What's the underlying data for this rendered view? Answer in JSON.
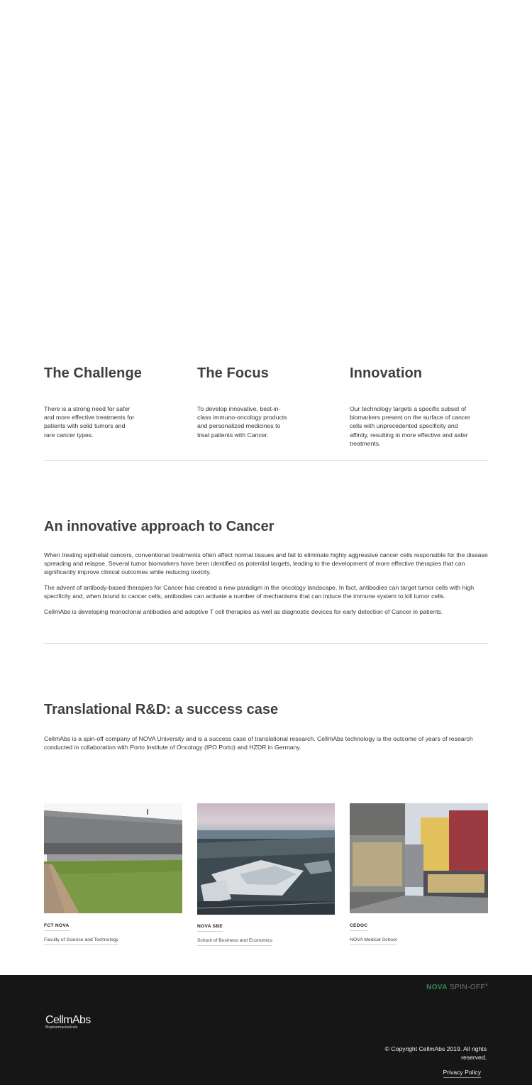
{
  "pillars": [
    {
      "title": "The Challenge",
      "lines": [
        "There is a strong need for safer",
        "and more effective treatments for",
        "patients with solid tumors and",
        "rare cancer types."
      ]
    },
    {
      "title": "The Focus",
      "lines": [
        "To develop innovative, best-in-",
        "class immuno-oncology products",
        "and personalized medicines to",
        "treat patients with Cancer."
      ]
    },
    {
      "title": "Innovation",
      "lines": [
        "Our technology targets a specific subset of",
        "biomarkers present on the surface of cancer",
        "cells with unprecedented specificity and",
        "affinity, resulting in more effective and safer",
        "treatments."
      ]
    }
  ],
  "approach": {
    "title": "An innovative approach to Cancer",
    "paragraphs": [
      "When treating epithelial cancers,  conventional treatments often affect normal tissues and fail to  eliminate highly aggressive cancer cells responsible for the disease  spreading and relapse. Several tumor biomarkers have been identified as  potential targets, leading to the development of more effective therapies that can significantly improve clinical outcomes while  reducing toxicity.",
      "The advent of antibody-based therapies for  Cancer has created a new paradigm in the oncology landscape. In fact,  antibodies can target tumor cells with high specificity and, when bound  to cancer cells, antibodies can activate a number of mechanisms that can  induce the immune system to kill tumor cells.",
      "CellmAbs is developing monoclonal antibodies and  adoptive T cell therapies as well as diagnostic devices for early  detection of Cancer in patients."
    ]
  },
  "translational": {
    "title": "Translational R&D: a success case",
    "paragraph": "CellmAbs is a spin-off company of NOVA University and  is a success case of translational research. CellmAbs technology is the  outcome of years of research conducted in collaboration with Porto Institute of Oncology (IPO Porto) and HZDR in Germany."
  },
  "partners": [
    {
      "name": "FCT NOVA",
      "subtitle": "Faculty of Science and Technology"
    },
    {
      "name": "NOVA SBE",
      "subtitle": "School of Business and Economics"
    },
    {
      "name": "CEDOC",
      "subtitle": "NOVA Medical School"
    }
  ],
  "footer": {
    "spinoff_nova": "NOVA",
    "spinoff_label": "SPIN-OFF",
    "spinoff_mark": "®",
    "logo_main": "CellmAbs",
    "logo_sub": "Biopharmaceuticals",
    "copyright_lines": [
      "© Copyright CellmAbs 2019. All rights",
      "reserved."
    ],
    "privacy": "Privacy Policy"
  },
  "colors": {
    "footer_bg": "#161616",
    "nova_green": "#2f8a4f",
    "heading": "#3f3f3f"
  }
}
